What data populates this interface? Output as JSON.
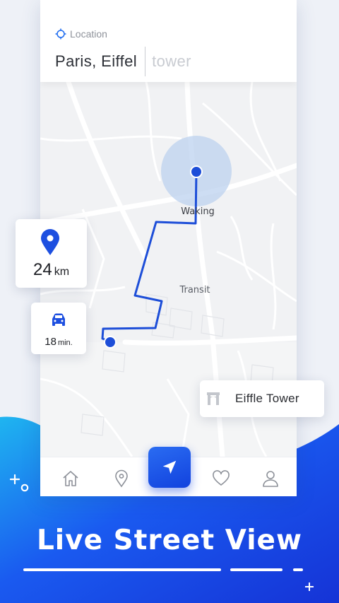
{
  "search": {
    "label": "Location",
    "typed_text": "Paris, Eiffel",
    "hint_text": "tower"
  },
  "map": {
    "labels": {
      "start": "Waking",
      "middle": "Transit"
    },
    "route_color": "#1d4ed8",
    "radius_color": "#bcd2ef"
  },
  "distance_card": {
    "value": "24",
    "unit": "km",
    "icon": "location-pin-icon"
  },
  "time_card": {
    "value": "18",
    "unit": "min.",
    "icon": "car-icon"
  },
  "destination_card": {
    "label": "Eiffle Tower",
    "icon": "monument-icon"
  },
  "bottom_nav": {
    "items": [
      "home-icon",
      "location-icon",
      "navigate-icon",
      "heart-icon",
      "profile-icon"
    ],
    "active": "navigate-icon",
    "accent_color": "#1a4fe6"
  },
  "headline": "Live Street View",
  "colors": {
    "wave_blue": "#1a4fe6",
    "wave_cyan": "#1fb5f0"
  }
}
